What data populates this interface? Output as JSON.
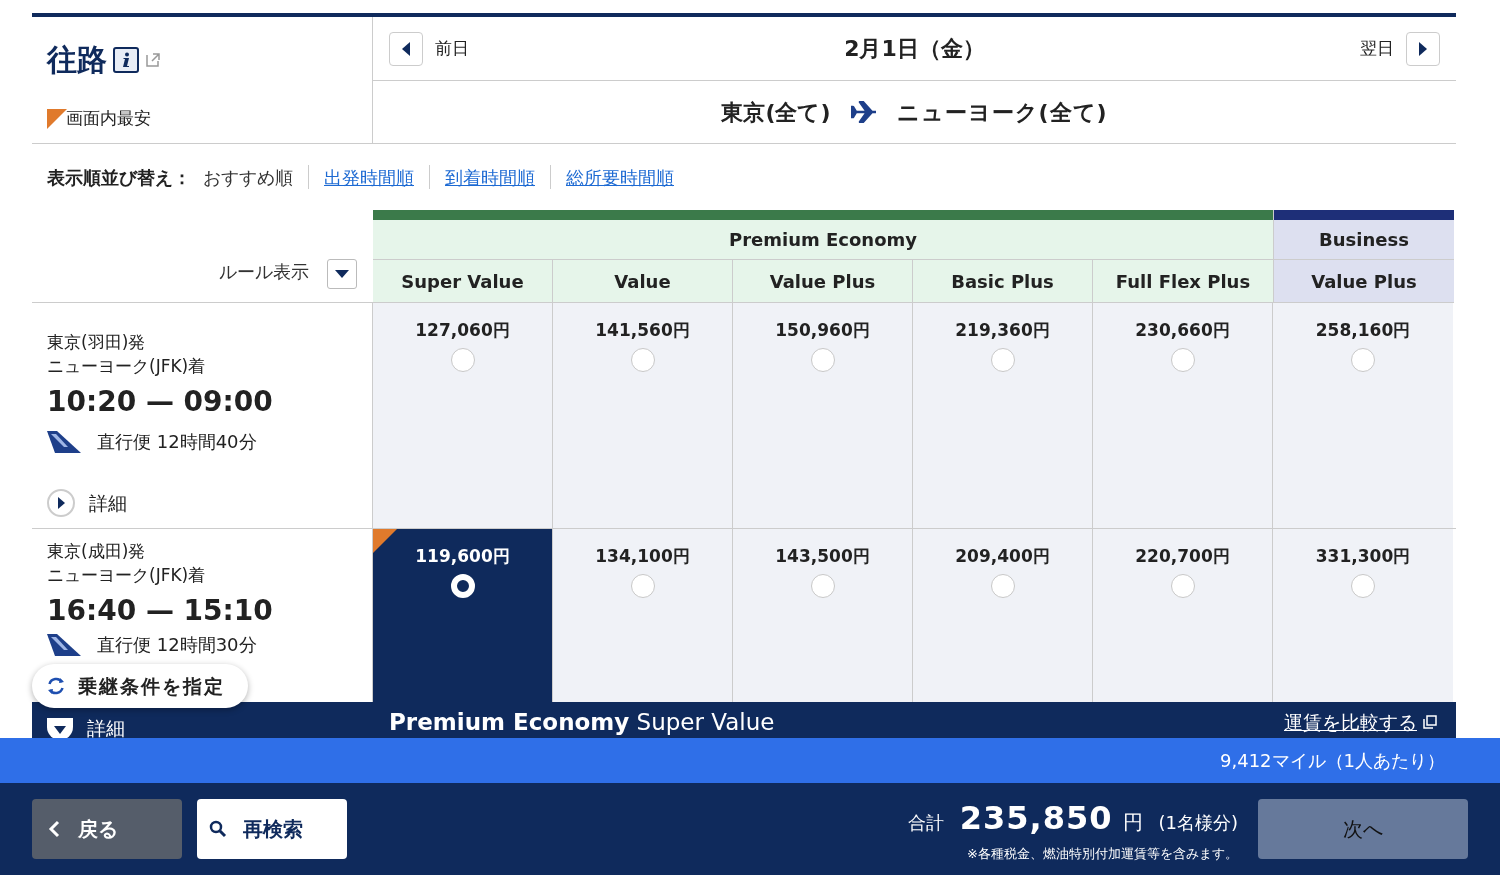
{
  "outbound": {
    "title": "往路",
    "legend": "画面内最安"
  },
  "date_nav": {
    "prev": "前日",
    "date": "2月1日（金）",
    "next": "翌日"
  },
  "route": {
    "from": "東京(全て)",
    "to": "ニューヨーク(全て)"
  },
  "sort": {
    "label": "表示順並び替え：",
    "options": [
      {
        "label": "おすすめ順",
        "selected": true
      },
      {
        "label": "出発時間順",
        "selected": false
      },
      {
        "label": "到着時間順",
        "selected": false
      },
      {
        "label": "総所要時間順",
        "selected": false
      }
    ]
  },
  "rule_toggle": "ルール表示",
  "cabins": [
    {
      "name": "Premium Economy",
      "color": "#3b7a4a",
      "fares": [
        "Super Value",
        "Value",
        "Value Plus",
        "Basic Plus",
        "Full Flex Plus"
      ]
    },
    {
      "name": "Business",
      "color": "#1e2f78",
      "fares": [
        "Value Plus"
      ]
    }
  ],
  "flights": [
    {
      "depart": "東京(羽田)発",
      "arrive": "ニューヨーク(JFK)着",
      "times": "10:20 — 09:00",
      "duration": "直行便 12時間40分",
      "detail": "詳細",
      "expanded": false,
      "prices": [
        {
          "price": "127,060円",
          "selected": false,
          "cheapest": false
        },
        {
          "price": "141,560円",
          "selected": false,
          "cheapest": false
        },
        {
          "price": "150,960円",
          "selected": false,
          "cheapest": false
        },
        {
          "price": "219,360円",
          "selected": false,
          "cheapest": false
        },
        {
          "price": "230,660円",
          "selected": false,
          "cheapest": false
        },
        {
          "price": "258,160円",
          "selected": false,
          "cheapest": false
        }
      ]
    },
    {
      "depart": "東京(成田)発",
      "arrive": "ニューヨーク(JFK)着",
      "times": "16:40 — 15:10",
      "duration": "直行便 12時間30分",
      "detail": "詳細",
      "expanded": true,
      "prices": [
        {
          "price": "119,600円",
          "selected": true,
          "cheapest": true
        },
        {
          "price": "134,100円",
          "selected": false,
          "cheapest": false
        },
        {
          "price": "143,500円",
          "selected": false,
          "cheapest": false
        },
        {
          "price": "209,400円",
          "selected": false,
          "cheapest": false
        },
        {
          "price": "220,700円",
          "selected": false,
          "cheapest": false
        },
        {
          "price": "331,300円",
          "selected": false,
          "cheapest": false
        }
      ]
    }
  ],
  "detail_bar": {
    "title": "**Premium Economy** Super Value",
    "compare_link": "運賃を比較する"
  },
  "floating_button": "乗継条件を指定",
  "miles": "9,412マイル（1人あたり）",
  "footer": {
    "back": "戻る",
    "research": "再検索",
    "total_label": "合計",
    "total": "235,850",
    "unit": "円",
    "per": "(1名様分)",
    "note": "※各種税金、燃油特別付加運賃等を含みます。",
    "next": "次へ"
  }
}
